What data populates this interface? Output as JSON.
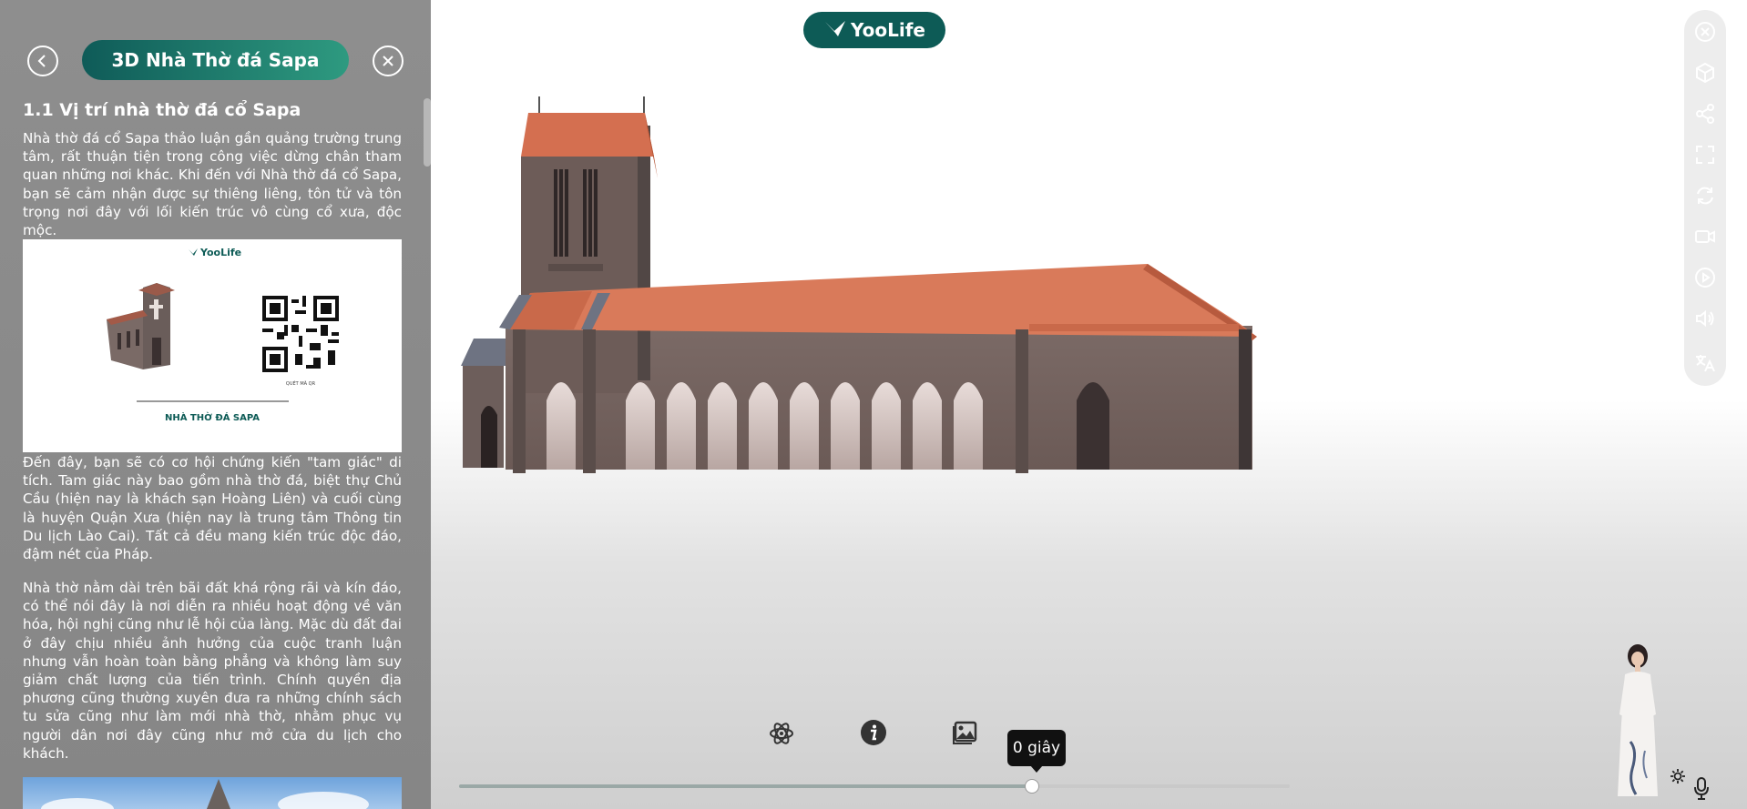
{
  "sidebar": {
    "title": "3D Nhà Thờ đá Sapa",
    "section_heading": "1.1 Vị trí nhà thờ đá cổ Sapa",
    "paragraphs": [
      "Nhà thờ đá cổ Sapa thảo luận gần quảng trường trung tâm, rất thuận tiện trong công việc dừng chân tham quan những nơi khác. Khi đến với Nhà thờ đá cổ Sapa, bạn sẽ cảm nhận được sự thiêng liêng, tôn tử và tôn trọng nơi đây với lối kiến trúc vô cùng cổ xưa, độc mộc.",
      "Đến đây, bạn sẽ có cơ hội chứng kiến \"tam giác\" di tích. Tam giác này bao gồm nhà thờ đá, biệt thự Chủ Cầu (hiện nay là khách sạn Hoàng Liên) và cuối cùng là huyện Quận Xưa (hiện nay là trung tâm Thông tin Du lịch Lào Cai). Tất cả đều mang kiến trúc độc đáo, đậm nét của Pháp.",
      "Nhà thờ nằm dài trên bãi đất khá rộng rãi và kín đáo, có thể nói đây là nơi diễn ra nhiều hoạt động về văn hóa, hội nghị cũng như lễ hội của làng. Mặc dù đất đai ở đây chịu nhiều ảnh hưởng của cuộc tranh luận nhưng vẫn hoàn toàn bằng phẳng và không làm suy giảm chất lượng của tiến trình. Chính quyền địa phương cũng thường xuyên đưa ra những chính sách tu sửa cũng như làm mới nhà thờ, nhằm phục vụ người dân nơi đây cũng như mở cửa du lịch cho khách."
    ],
    "info_card": {
      "brand": "YooLife",
      "qr_caption": "QUÉT MÃ QR",
      "caption": "NHÀ THỜ ĐÁ SAPA"
    }
  },
  "header": {
    "logo_text": "YooLife"
  },
  "toolbar": {
    "icons": [
      "close-icon",
      "cube-icon",
      "share-icon",
      "fullscreen-icon",
      "rotate-icon",
      "video-icon",
      "play-icon",
      "volume-icon",
      "translate-icon"
    ]
  },
  "controls": {
    "icons": [
      "atom-icon",
      "info-icon",
      "gallery-icon"
    ],
    "tooltip": "0 giây",
    "progress": 0.69
  },
  "colors": {
    "brand": "#0d5b56",
    "pill_start": "#0f5b58",
    "pill_end": "#2e9a80"
  }
}
